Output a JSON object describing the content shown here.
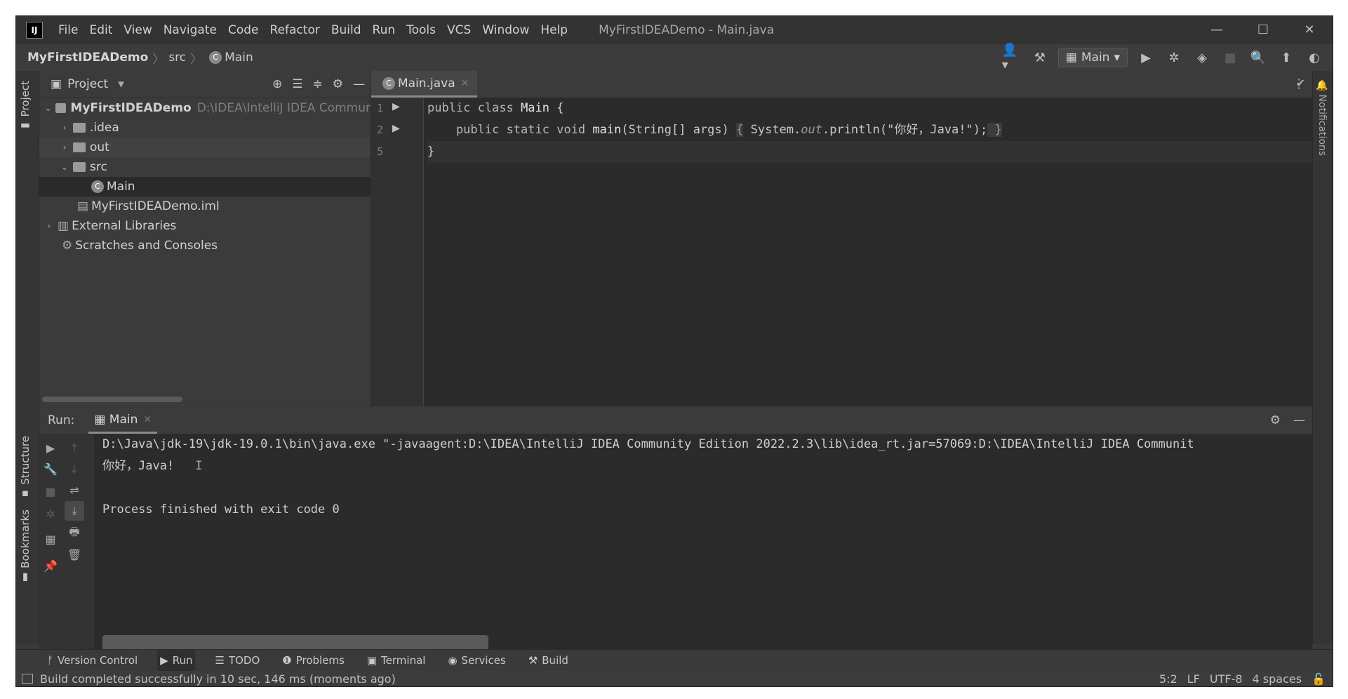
{
  "titlebar": {
    "logo": "IJ",
    "menu": [
      "File",
      "Edit",
      "View",
      "Navigate",
      "Code",
      "Refactor",
      "Build",
      "Run",
      "Tools",
      "VCS",
      "Window",
      "Help"
    ],
    "title": "MyFirstIDEADemo - Main.java"
  },
  "navbar": {
    "crumbs": [
      "MyFirstIDEADemo",
      "src",
      "Main"
    ],
    "run_config": "Main"
  },
  "left_strip": {
    "project": "Project",
    "structure": "Structure",
    "bookmarks": "Bookmarks"
  },
  "right_strip": {
    "notifications": "Notifications"
  },
  "project": {
    "header": "Project",
    "tree": {
      "root": "MyFirstIDEADemo",
      "root_path": "D:\\IDEA\\IntelliJ IDEA Commur",
      "idea": ".idea",
      "out": "out",
      "src": "src",
      "main": "Main",
      "iml": "MyFirstIDEADemo.iml",
      "libs": "External Libraries",
      "scratches": "Scratches and Consoles"
    }
  },
  "editor": {
    "tab": "Main.java",
    "line_numbers": [
      "1",
      "2",
      "5"
    ],
    "lines": {
      "l1_kw": "public class ",
      "l1_name": "Main",
      "l1_brace": " {",
      "l2_kw": "    public static void ",
      "l2_fn": "main",
      "l2_args": "(String[] args) ",
      "l2_open": "{",
      "l2_sys": " System.",
      "l2_out": "out",
      "l2_print": ".println(\"你好，Java!\");",
      "l2_close": " }",
      "l3": "}"
    }
  },
  "run": {
    "label": "Run:",
    "tab": "Main",
    "console": [
      "D:\\Java\\jdk-19\\jdk-19.0.1\\bin\\java.exe \"-javaagent:D:\\IDEA\\IntelliJ IDEA Community Edition 2022.2.3\\lib\\idea_rt.jar=57069:D:\\IDEA\\IntelliJ IDEA Communit",
      "你好，Java!",
      "",
      "Process finished with exit code 0"
    ]
  },
  "bottom_tabs": [
    "Version Control",
    "Run",
    "TODO",
    "Problems",
    "Terminal",
    "Services",
    "Build"
  ],
  "status": {
    "message": "Build completed successfully in 10 sec, 146 ms (moments ago)",
    "position": "5:2",
    "line_sep": "LF",
    "encoding": "UTF-8",
    "indent": "4 spaces"
  }
}
